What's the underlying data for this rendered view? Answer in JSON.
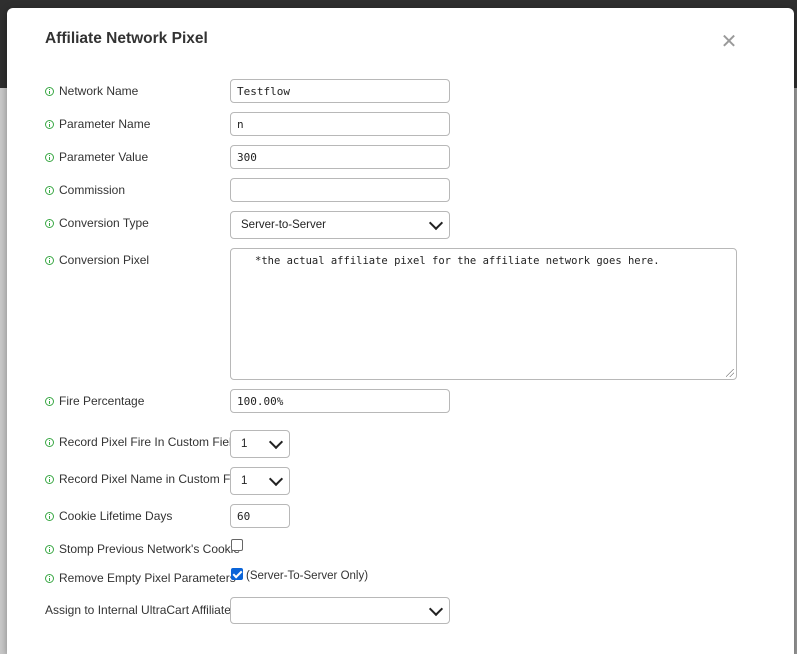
{
  "dialog": {
    "title": "Affiliate Network Pixel",
    "close_glyph": "✕"
  },
  "fields": {
    "network_name": {
      "label": "Network Name",
      "value": "Testflow"
    },
    "parameter_name": {
      "label": "Parameter Name",
      "value": "n"
    },
    "parameter_value": {
      "label": "Parameter Value",
      "value": "300"
    },
    "commission": {
      "label": "Commission",
      "value": ""
    },
    "conversion_type": {
      "label": "Conversion Type",
      "value": "Server-to-Server"
    },
    "conversion_pixel": {
      "label": "Conversion Pixel",
      "value": "*the actual affiliate pixel for the affiliate network goes here."
    },
    "fire_percentage": {
      "label": "Fire Percentage",
      "value": "100.00%"
    },
    "record_fire": {
      "label": "Record Pixel Fire In Custom Field",
      "value": "1"
    },
    "record_name": {
      "label": "Record Pixel Name in Custom Field",
      "value": "1"
    },
    "cookie_lifetime": {
      "label": "Cookie Lifetime Days",
      "value": "60"
    },
    "stomp_cookie": {
      "label": "Stomp Previous Network's Cookie",
      "checked": false
    },
    "remove_empty": {
      "label": "Remove Empty Pixel Parameters",
      "checked": true,
      "note": "(Server-To-Server Only)"
    },
    "assign_affiliate": {
      "label": "Assign to Internal UltraCart Affiliate",
      "value": ""
    }
  },
  "colors": {
    "info_icon": "#3aa845",
    "checkbox_checked": "#0b64d8"
  }
}
